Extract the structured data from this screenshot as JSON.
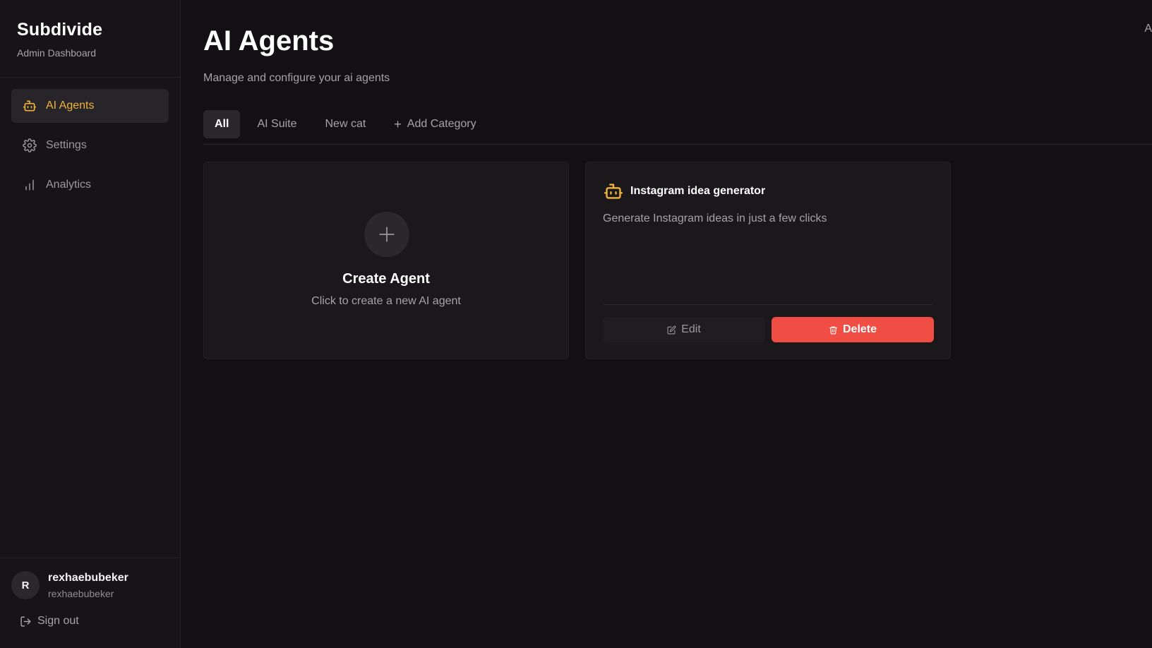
{
  "brand": {
    "title": "Subdivide",
    "subtitle": "Admin Dashboard"
  },
  "sidebar": {
    "items": [
      {
        "label": "AI Agents",
        "icon": "bot-icon",
        "active": true
      },
      {
        "label": "Settings",
        "icon": "gear-icon",
        "active": false
      },
      {
        "label": "Analytics",
        "icon": "bar-chart-icon",
        "active": false
      }
    ]
  },
  "user": {
    "initial": "R",
    "name": "rexhaebubeker",
    "handle": "rexhaebubeker",
    "signout_label": "Sign out"
  },
  "header": {
    "title": "AI Agents",
    "subtitle": "Manage and configure your ai agents",
    "corner_glyph": "A"
  },
  "tabs": [
    {
      "label": "All",
      "active": true
    },
    {
      "label": "AI Suite",
      "active": false
    },
    {
      "label": "New cat",
      "active": false
    }
  ],
  "add_category_label": "Add Category",
  "create_card": {
    "title": "Create Agent",
    "subtitle": "Click to create a new AI agent"
  },
  "agents": [
    {
      "name": "Instagram idea generator",
      "description": "Generate Instagram ideas in just a few clicks",
      "edit_label": "Edit",
      "delete_label": "Delete"
    }
  ],
  "colors": {
    "accent": "#f0b43c",
    "danger": "#f04d44",
    "background": "#121013"
  }
}
